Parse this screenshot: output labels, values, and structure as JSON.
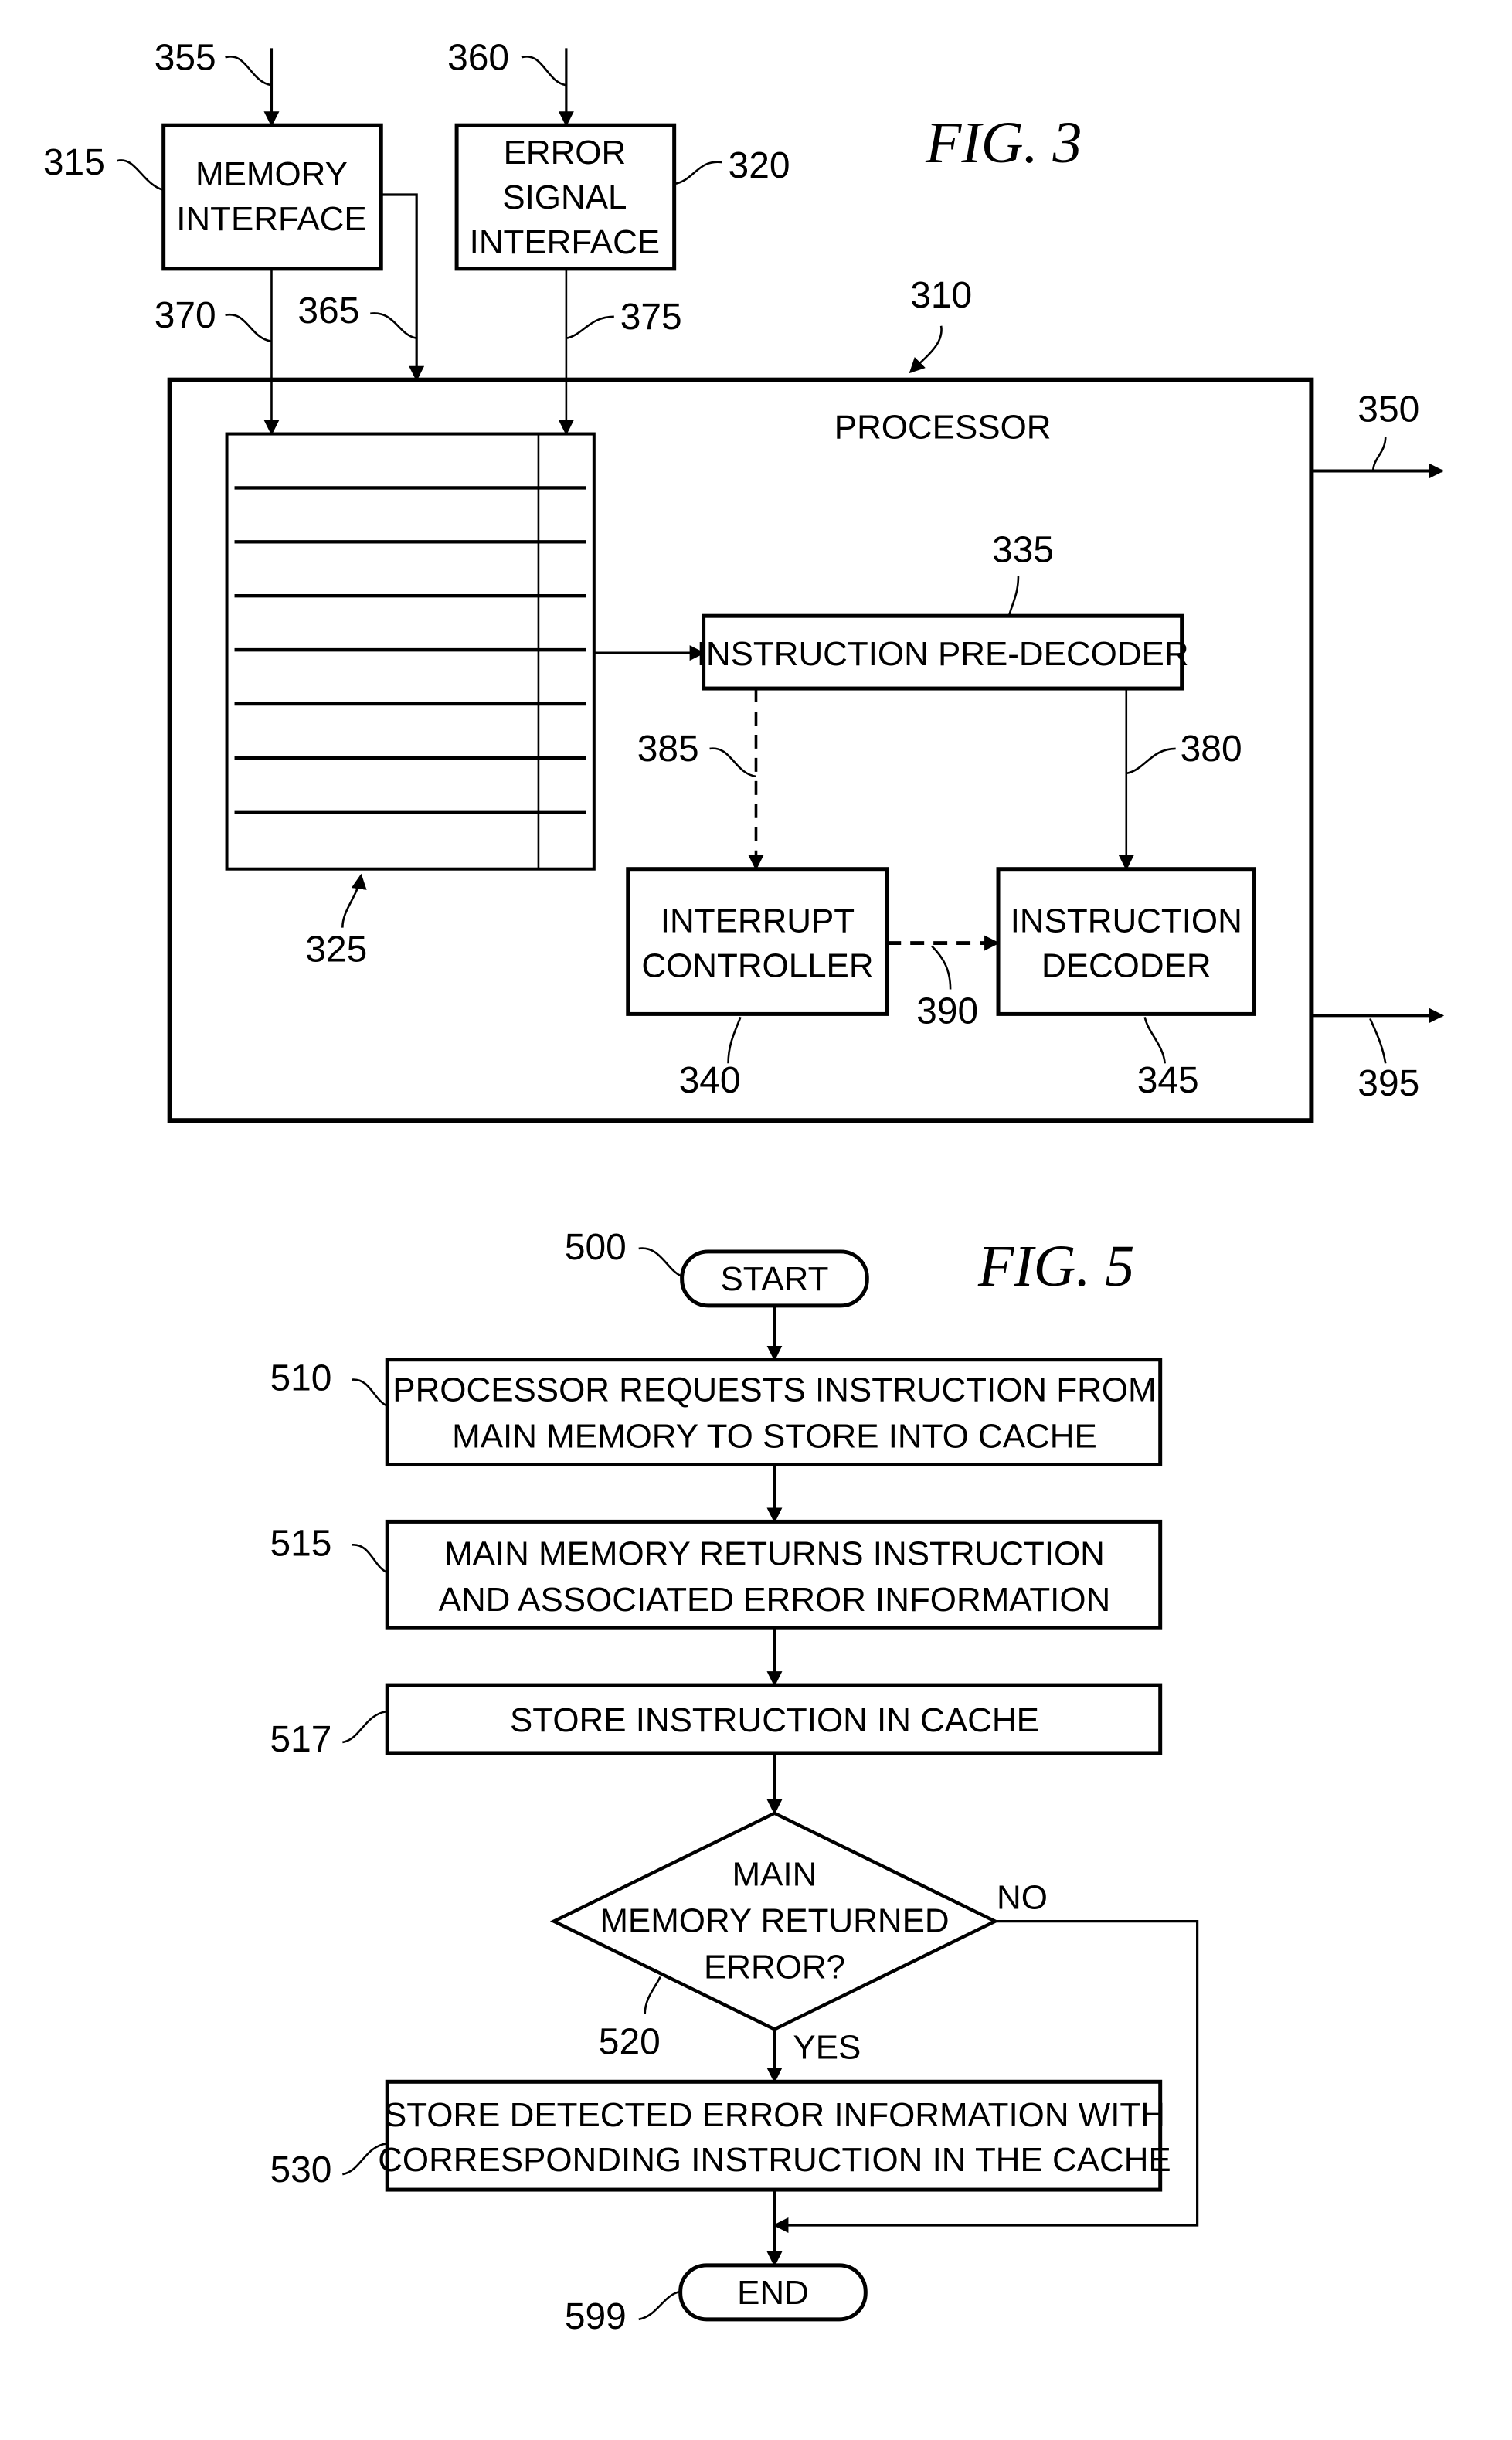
{
  "fig3": {
    "title": "FIG. 3",
    "memory_interface": {
      "lines": [
        "MEMORY",
        "INTERFACE"
      ],
      "ref": "315"
    },
    "error_signal_interface": {
      "lines": [
        "ERROR",
        "SIGNAL",
        "INTERFACE"
      ],
      "ref": "320"
    },
    "processor": {
      "label": "PROCESSOR",
      "ref": "310"
    },
    "cache": {
      "ref": "325"
    },
    "pre_decoder": {
      "label": "INSTRUCTION PRE-DECODER",
      "ref": "335"
    },
    "interrupt_controller": {
      "lines": [
        "INTERRUPT",
        "CONTROLLER"
      ],
      "ref": "340"
    },
    "instruction_decoder": {
      "lines": [
        "INSTRUCTION",
        "DECODER"
      ],
      "ref": "345"
    },
    "refs": {
      "r355": "355",
      "r360": "360",
      "r365": "365",
      "r370": "370",
      "r375": "375",
      "r350": "350",
      "r380": "380",
      "r385": "385",
      "r390": "390",
      "r395": "395"
    }
  },
  "fig5": {
    "title": "FIG. 5",
    "start": {
      "label": "START",
      "ref": "500"
    },
    "step510": {
      "lines": [
        "PROCESSOR REQUESTS INSTRUCTION FROM",
        "MAIN MEMORY TO STORE INTO CACHE"
      ],
      "ref": "510"
    },
    "step515": {
      "lines": [
        "MAIN MEMORY RETURNS INSTRUCTION",
        "AND ASSOCIATED ERROR INFORMATION"
      ],
      "ref": "515"
    },
    "step517": {
      "label": "STORE INSTRUCTION IN CACHE",
      "ref": "517"
    },
    "decision520": {
      "lines": [
        "MAIN",
        "MEMORY RETURNED",
        "ERROR?"
      ],
      "ref": "520",
      "no_label": "NO",
      "yes_label": "YES"
    },
    "step530": {
      "lines": [
        "STORE DETECTED ERROR INFORMATION WITH",
        "CORRESPONDING INSTRUCTION IN THE CACHE"
      ],
      "ref": "530"
    },
    "end": {
      "label": "END",
      "ref": "599"
    }
  }
}
